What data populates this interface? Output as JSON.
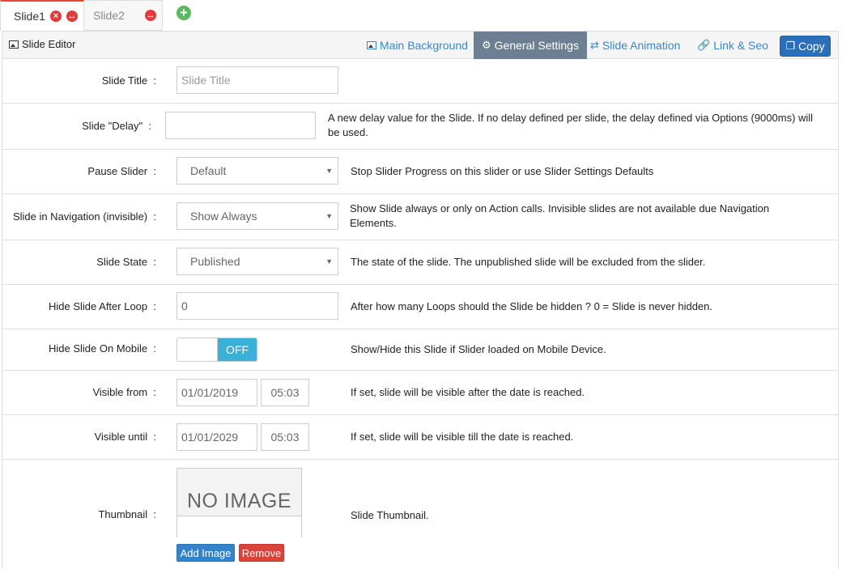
{
  "slide_tabs": [
    {
      "label": "Slide1",
      "active": true
    },
    {
      "label": "Slide2",
      "active": false
    }
  ],
  "icons": {
    "delete": "×",
    "duplicate": "↔",
    "add": "+",
    "dropdown": "▼",
    "label_sep": ":"
  },
  "editor": {
    "title": "Slide Editor",
    "tabs": {
      "main_background": "Main Background",
      "general_settings": "General Settings",
      "slide_animation": "Slide Animation",
      "link_seo": "Link & Seo"
    },
    "copy_label": "Copy"
  },
  "form": {
    "slide_title": {
      "label": "Slide Title",
      "placeholder": "Slide Title"
    },
    "slide_delay": {
      "label": "Slide \"Delay\"",
      "value": "",
      "description": "A new delay value for the Slide. If no delay defined per slide, the delay defined via Options (9000ms) will be used."
    },
    "pause_slider": {
      "label": "Pause Slider",
      "value": "Default",
      "description": "Stop Slider Progress on this slider or use Slider Settings Defaults"
    },
    "slide_in_navigation": {
      "label": "Slide in Navigation (invisible)",
      "value": "Show Always",
      "description": "Show Slide always or only on Action calls. Invisible slides are not available due Navigation Elements."
    },
    "slide_state": {
      "label": "Slide State",
      "value": "Published",
      "description": "The state of the slide. The unpublished slide will be excluded from the slider."
    },
    "hide_after_loop": {
      "label": "Hide Slide After Loop",
      "value": "0",
      "description": "After how many Loops should the Slide be hidden ? 0 = Slide is never hidden."
    },
    "hide_on_mobile": {
      "label": "Hide Slide On Mobile",
      "toggle_label": "OFF",
      "description": "Show/Hide this Slide if Slider loaded on Mobile Device."
    },
    "visible_from": {
      "label": "Visible from",
      "date": "01/01/2019",
      "time": "05:03",
      "description": "If set, slide will be visible after the date is reached."
    },
    "visible_until": {
      "label": "Visible until",
      "date": "01/01/2029",
      "time": "05:03",
      "description": "If set, slide will be visible till the date is reached."
    },
    "thumbnail": {
      "label": "Thumbnail",
      "placeholder_text": "NO IMAGE",
      "add_label": "Add Image",
      "remove_label": "Remove",
      "description": "Slide Thumbnail."
    }
  }
}
